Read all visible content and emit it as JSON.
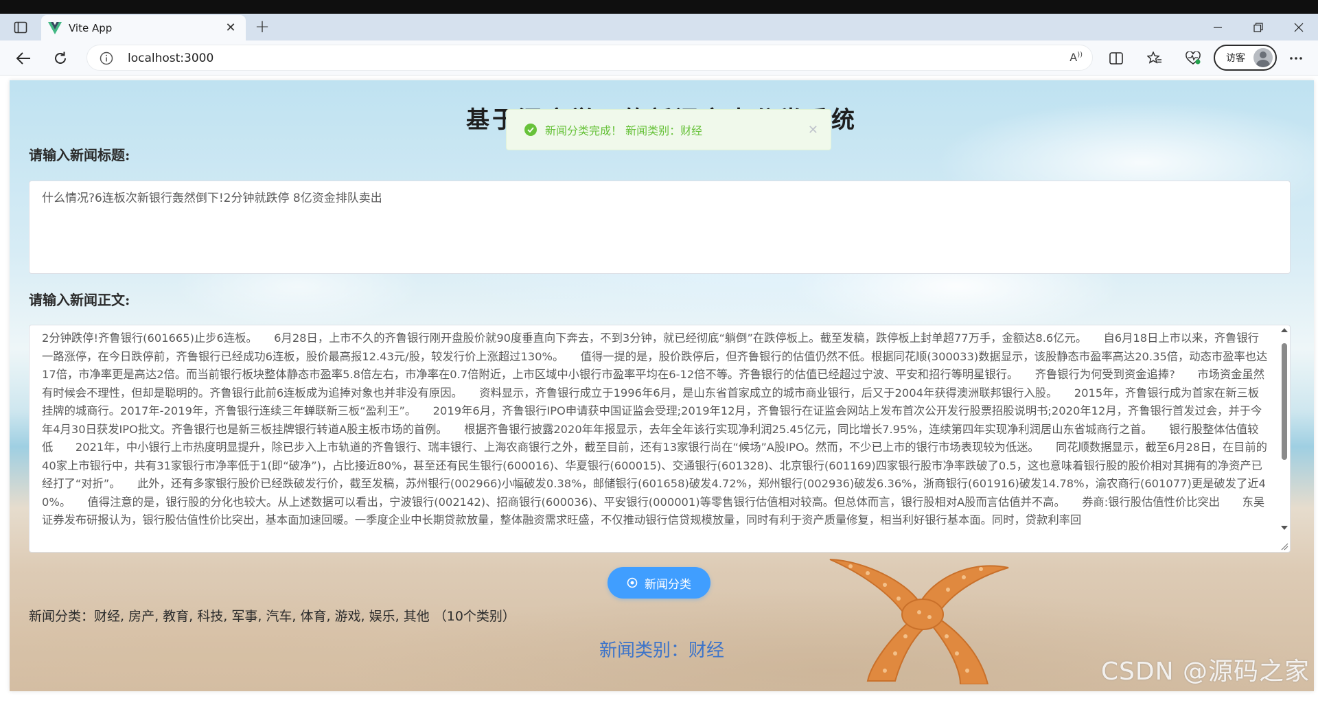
{
  "browser": {
    "tab_title": "Vite App",
    "address": "localhost:3000",
    "profile_label": "访客",
    "colors": {
      "vite_logo": "#41b883",
      "tabbar": "#d6e1ee"
    }
  },
  "page": {
    "title": "基于深度学习的新闻文本分类系统",
    "title_label": "请输入新闻标题:",
    "title_value": "什么情况?6连板次新银行轰然倒下!2分钟就跌停 8亿资金排队卖出",
    "content_label": "请输入新闻正文:",
    "content_value": "2分钟跌停!齐鲁银行(601665)止步6连板。　　6月28日，上市不久的齐鲁银行刚开盘股价就90度垂直向下奔去，不到3分钟，就已经彻底“躺倒”在跌停板上。截至发稿，跌停板上封单超77万手，金额达8.6亿元。　　自6月18日上市以来，齐鲁银行一路涨停，在今日跌停前，齐鲁银行已经成功6连板，股价最高报12.43元/股，较发行价上涨超过130%。　　值得一提的是，股价跌停后，但齐鲁银行的估值仍然不低。根据同花顺(300033)数据显示，该股静态市盈率高达20.35倍，动态市盈率也达17倍，市净率更是高达2倍。而当前银行板块整体静态市盈率5.8倍左右，市净率在0.7倍附近，上市区域中小银行市盈率平均在6-12倍不等。齐鲁银行的估值已经超过宁波、平安和招行等明星银行。　　齐鲁银行为何受到资金追捧?　　市场资金虽然有时候会不理性，但却是聪明的。齐鲁银行此前6连板成为追捧对象也并非没有原因。　　资料显示，齐鲁银行成立于1996年6月，是山东省首家成立的城市商业银行，后又于2004年获得澳洲联邦银行入股。　　2015年，齐鲁银行成为首家在新三板挂牌的城商行。2017年-2019年，齐鲁银行连续三年蝉联新三板“盈利王”。　　2019年6月，齐鲁银行IPO申请获中国证监会受理;2019年12月，齐鲁银行在证监会网站上发布首次公开发行股票招股说明书;2020年12月，齐鲁银行首发过会，并于今年4月30日获发IPO批文。齐鲁银行也是新三板挂牌银行转道A股主板市场的首例。　　根据齐鲁银行披露2020年年报显示，去年全年该行实现净利润25.45亿元，同比增长7.95%，连续第四年实现净利润居山东省城商行之首。　　银行股整体估值较低　　2021年，中小银行上市热度明显提升，除已步入上市轨道的齐鲁银行、瑞丰银行、上海农商银行之外，截至目前，还有13家银行尚在“候场”A股IPO。然而，不少已上市的银行市场表现较为低迷。　　同花顺数据显示，截至6月28日，在目前的40家上市银行中，共有31家银行市净率低于1(即“破净”)，占比接近80%，甚至还有民生银行(600016)、华夏银行(600015)、交通银行(601328)、北京银行(601169)四家银行股市净率跌破了0.5，这也意味着银行股的股价相对其拥有的净资产已经打了“对折”。　　此外，还有多家银行股价已经跌破发行价，截至发稿，苏州银行(002966)小幅破发0.38%，邮储银行(601658)破发4.72%，郑州银行(002936)破发6.36%，浙商银行(601916)破发14.78%，渝农商行(601077)更是破发了近40%。　　值得注意的是，银行股的分化也较大。从上述数据可以看出，宁波银行(002142)、招商银行(600036)、平安银行(000001)等零售银行估值相对较高。但总体而言，银行股相对A股而言估值并不高。　　券商:银行股估值性价比突出　　东吴证券发布研报认为，银行股估值性价比突出，基本面加速回暖。一季度企业中长期贷款放量，整体融资需求旺盛，不仅推动银行信贷规模放量，同时有利于资产质量修复，相当利好银行基本面。同时，贷款利率回",
    "classify_button": "新闻分类",
    "categories_text": "新闻分类：财经, 房产, 教育, 科技, 军事, 汽车, 体育, 游戏, 娱乐, 其他 （10个类别）",
    "result_text": "新闻类别：财经",
    "toast_text": "新闻分类完成！ 新闻类别：财经",
    "watermark": "CSDN @源码之家",
    "colors": {
      "primary_button": "#409eff",
      "result_text": "#3d74c9",
      "toast_success": "#67c23a"
    }
  }
}
